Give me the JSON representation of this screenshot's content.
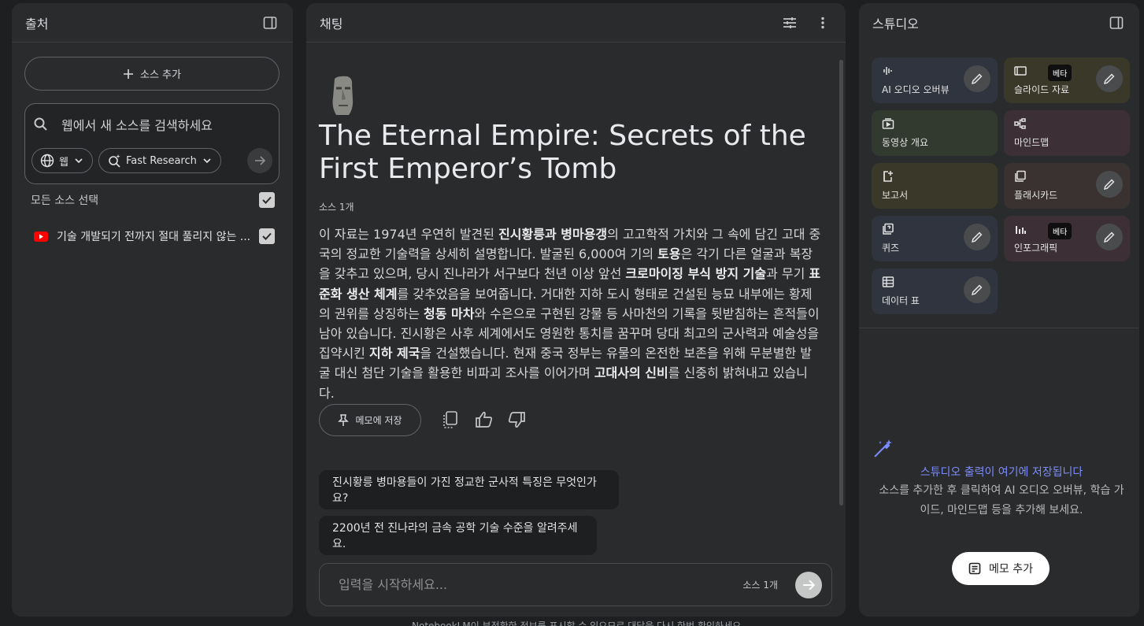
{
  "sources_panel": {
    "title": "출처",
    "add_source_label": "소스 추가",
    "search_placeholder": "웹에서 새 소스를 검색하세요",
    "web_chip_label": "웹",
    "research_chip_label": "Fast Research",
    "select_all_label": "모든 소스 선택",
    "sources": [
      {
        "title": "기술 개발되기 전까지 절대 풀리지 않는 ...",
        "type": "youtube",
        "checked": true
      }
    ]
  },
  "chat_panel": {
    "title": "채팅",
    "notebook_title": "The Eternal Empire: Secrets of the First Emperor’s Tomb",
    "source_count": "소스 1개",
    "summary_segments": [
      {
        "text": "이 자료는 1974년 우연히 발견된 ",
        "bold": false
      },
      {
        "text": "진시황릉과 병마용갱",
        "bold": true
      },
      {
        "text": "의 고고학적 가치와 그 속에 담긴 고대 중국의 정교한 기술력을 상세히 설명합니다. 발굴된 6,000여 기의 ",
        "bold": false
      },
      {
        "text": "토용",
        "bold": true
      },
      {
        "text": "은 각기 다른 얼굴과 복장을 갖추고 있으며, 당시 진나라가 서구보다 천년 이상 앞선 ",
        "bold": false
      },
      {
        "text": "크로마이징 부식 방지 기술",
        "bold": true
      },
      {
        "text": "과 무기 ",
        "bold": false
      },
      {
        "text": "표준화 생산 체계",
        "bold": true
      },
      {
        "text": "를 갖추었음을 보여줍니다. 거대한 지하 도시 형태로 건설된 능묘 내부에는 황제의 권위를 상징하는 ",
        "bold": false
      },
      {
        "text": "청동 마차",
        "bold": true
      },
      {
        "text": "와 수은으로 구현된 강물 등 사마천의 기록을 뒷받침하는 흔적들이 남아 있습니다. 진시황은 사후 세계에서도 영원한 통치를 꿈꾸며 당대 최고의 군사력과 예술성을 집약시킨 ",
        "bold": false
      },
      {
        "text": "지하 제국",
        "bold": true
      },
      {
        "text": "을 건설했습니다. 현재 중국 정부는 유물의 온전한 보존을 위해 무분별한 발굴 대신 첨단 기술을 활용한 비파괴 조사를 이어가며 ",
        "bold": false
      },
      {
        "text": "고대사의 신비",
        "bold": true
      },
      {
        "text": "를 신중히 밝혀내고 있습니다.",
        "bold": false
      }
    ],
    "save_memo_label": "메모에 저장",
    "suggestions": [
      "진시황릉 병마용들이 가진 정교한 군사적 특징은 무엇인가요?",
      "2200년 전 진나라의 금속 공학 기술 수준을 알려주세요."
    ],
    "input_placeholder": "입력을 시작하세요...",
    "input_source_count": "소스 1개"
  },
  "studio_panel": {
    "title": "스튜디오",
    "tiles": [
      {
        "label": "AI 오디오 오버뷰",
        "icon": "audio-waveform-icon",
        "color": "#30343f",
        "editable": true,
        "beta": false
      },
      {
        "label": "슬라이드 자료",
        "icon": "slides-icon",
        "color": "#3a3828",
        "editable": true,
        "beta": true
      },
      {
        "label": "동영상 개요",
        "icon": "video-icon",
        "color": "#323a30",
        "editable": false,
        "beta": false
      },
      {
        "label": "마인드맵",
        "icon": "mindmap-icon",
        "color": "#3c3036",
        "editable": false,
        "beta": false
      },
      {
        "label": "보고서",
        "icon": "report-icon",
        "color": "#3a3828",
        "editable": false,
        "beta": false
      },
      {
        "label": "플래시카드",
        "icon": "flashcards-icon",
        "color": "#3a3230",
        "editable": true,
        "beta": false
      },
      {
        "label": "퀴즈",
        "icon": "quiz-icon",
        "color": "#30343f",
        "editable": true,
        "beta": false
      },
      {
        "label": "인포그래픽",
        "icon": "infographic-icon",
        "color": "#3c3036",
        "editable": true,
        "beta": true
      },
      {
        "label": "데이터 표",
        "icon": "data-table-icon",
        "color": "#30343f",
        "editable": true,
        "beta": false
      }
    ],
    "beta_label": "베타",
    "empty_title": "스튜디오 출력이 여기에 저장됩니다",
    "empty_desc": "소스를 추가한 후 클릭하여 AI 오디오 오버뷰, 학습 가이드, 마인드맵 등을 추가해 보세요.",
    "add_memo_label": "메모 추가",
    "accent_color": "#7b8cff"
  },
  "footer_text": "NotebookLM이 부정확한 정보를 표시할 수 있으므로 대답을 다시 한번 확인하세요."
}
